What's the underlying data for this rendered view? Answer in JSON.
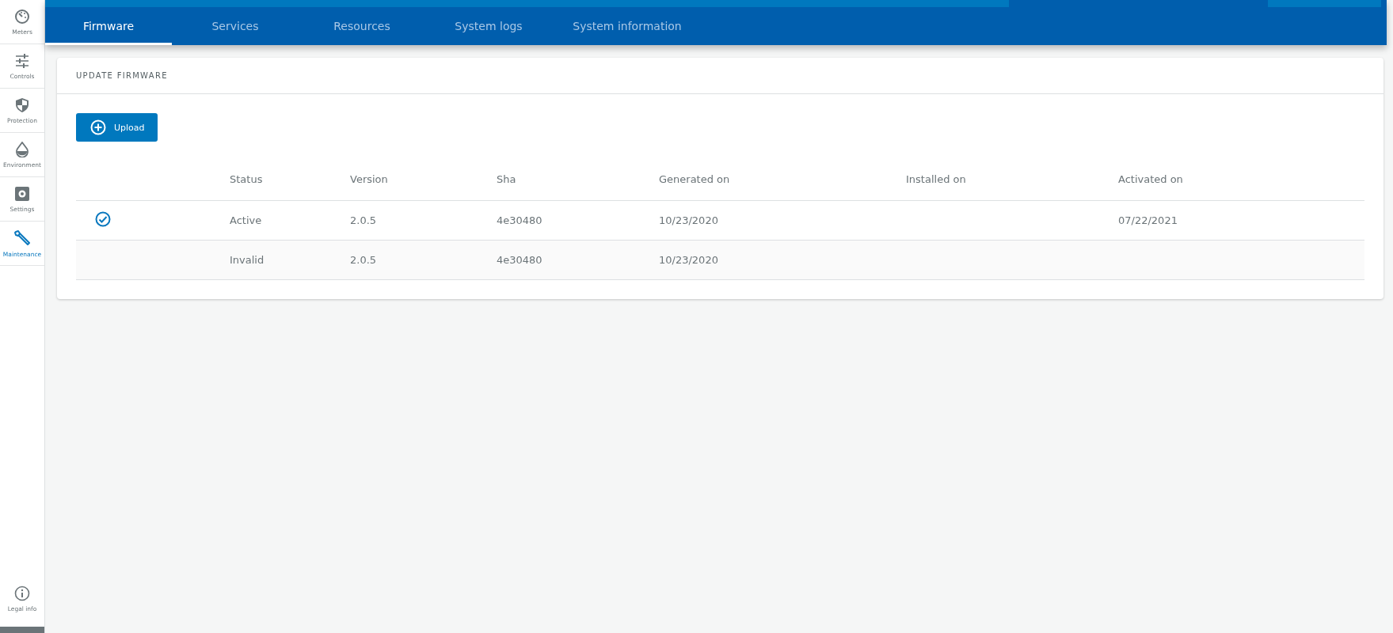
{
  "sidebar": {
    "items": [
      {
        "label": "Meters",
        "selected": false
      },
      {
        "label": "Controls",
        "selected": false
      },
      {
        "label": "Protection",
        "selected": false
      },
      {
        "label": "Environment",
        "selected": false
      },
      {
        "label": "Settings",
        "selected": false
      },
      {
        "label": "Maintenance",
        "selected": true
      }
    ],
    "footer": {
      "label": "Legal info"
    }
  },
  "tabs": [
    {
      "label": "Firmware",
      "selected": true
    },
    {
      "label": "Services",
      "selected": false
    },
    {
      "label": "Resources",
      "selected": false
    },
    {
      "label": "System logs",
      "selected": false
    },
    {
      "label": "System information",
      "selected": false
    }
  ],
  "card": {
    "title": "UPDATE FIRMWARE",
    "upload_button": "Upload",
    "table": {
      "columns": [
        "Status",
        "Version",
        "Sha",
        "Generated on",
        "Installed on",
        "Activated on"
      ],
      "rows": [
        {
          "active": true,
          "cells": [
            "Active",
            "2.0.5",
            "4e30480",
            "10/23/2020",
            "",
            "07/22/2021"
          ]
        },
        {
          "active": false,
          "cells": [
            "Invalid",
            "2.0.5",
            "4e30480",
            "10/23/2020",
            "",
            ""
          ]
        }
      ]
    }
  }
}
